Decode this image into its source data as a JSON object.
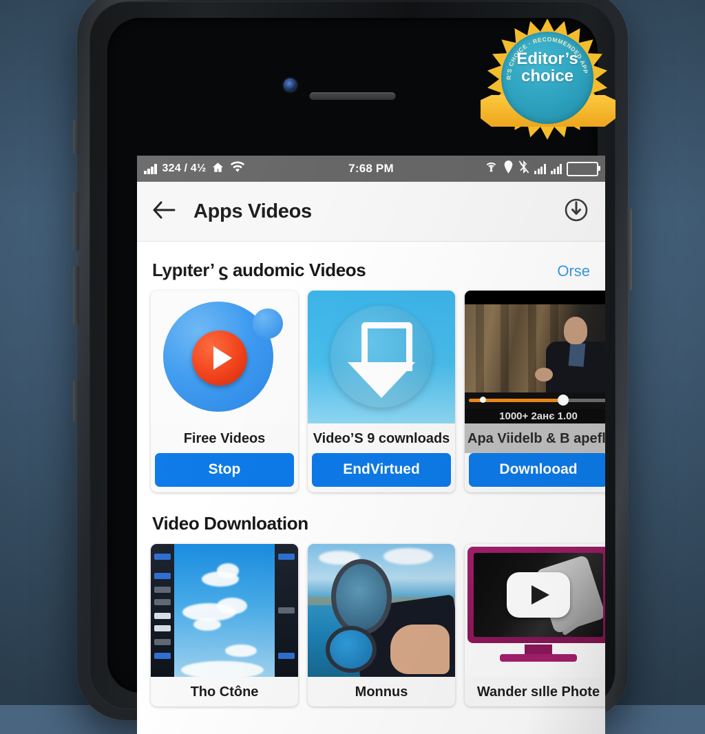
{
  "statusbar": {
    "signal_icon": "signal-bars-icon",
    "data_text": "324 / 4½",
    "home_icon": "home-icon",
    "wifi_icon": "wifi-icon",
    "time": "7:68 PM",
    "right_icons": [
      "wifi-tether-icon",
      "location-pin-icon",
      "bluetooth-off-icon",
      "signal-bars-icon",
      "signal-bars-icon",
      "battery-icon"
    ]
  },
  "appbar": {
    "back_icon": "back-arrow-icon",
    "title": "Apps Videos",
    "action_icon": "download-power-icon"
  },
  "sections": [
    {
      "title": "Lypıter’ ϛ audomic Videos",
      "more_label": "Orse",
      "cards": [
        {
          "label": "Firee Videos",
          "cta": "Stop",
          "icon": "play-circle-app-icon"
        },
        {
          "label": "Video’S 9 cownloads",
          "cta": "EndVirtued",
          "icon": "download-arrow-app-icon"
        },
        {
          "label": "Apa Viidelb & B apeflen",
          "cta": "Downlooad",
          "icon": "video-thumbnail",
          "video_meta": "1000+ 2анє 1.00",
          "progress": 68
        }
      ]
    },
    {
      "title": "Video Downloation",
      "more_label": "",
      "cards": [
        {
          "label": "Tho Ctône",
          "icon": "sky-clouds-thumbnail"
        },
        {
          "label": "Monnus",
          "icon": "seaside-binoculars-thumbnail"
        },
        {
          "label": "Wander sılle Phote",
          "icon": "monitor-play-thumbnail"
        }
      ]
    }
  ],
  "badge": {
    "line1": "Editor’s",
    "line2": "choice",
    "arc_text": "★ EDITOR’S CHOICE · RECOMMENDED APP AWARD ★"
  },
  "colors": {
    "accent_blue": "#0d7ae8",
    "link_blue": "#3a9ae0",
    "badge_teal": "#2ca0bd",
    "badge_gold": "#f5bd2b",
    "statusbar_grey": "#676767",
    "progress_orange": "#f08a1a"
  }
}
